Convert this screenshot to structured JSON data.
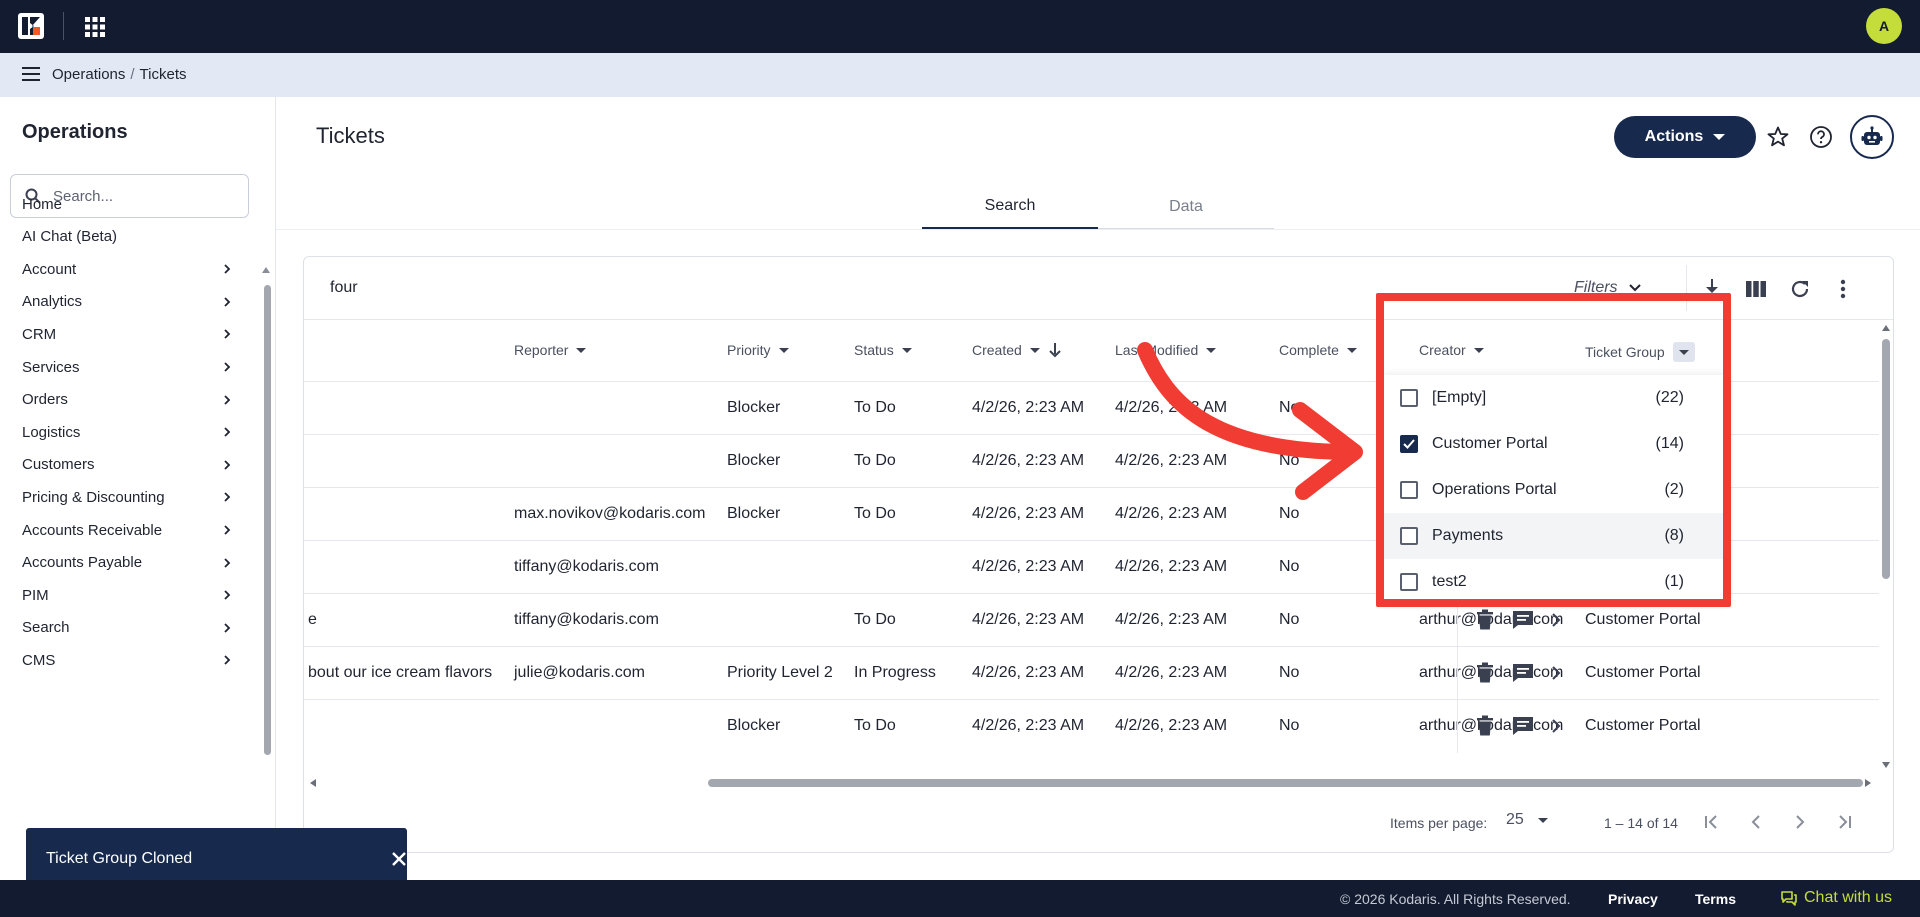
{
  "topbar": {
    "avatar_initial": "A"
  },
  "breadcrumb": {
    "items": [
      "Operations",
      "Tickets"
    ],
    "separator": "/"
  },
  "sidebar": {
    "title": "Operations",
    "search_placeholder": "Search...",
    "items": [
      {
        "label": "Home",
        "has_children": false
      },
      {
        "label": "AI Chat (Beta)",
        "has_children": false
      },
      {
        "label": "Account",
        "has_children": true
      },
      {
        "label": "Analytics",
        "has_children": true
      },
      {
        "label": "CRM",
        "has_children": true
      },
      {
        "label": "Services",
        "has_children": true
      },
      {
        "label": "Orders",
        "has_children": true
      },
      {
        "label": "Logistics",
        "has_children": true
      },
      {
        "label": "Customers",
        "has_children": true
      },
      {
        "label": "Pricing & Discounting",
        "has_children": true
      },
      {
        "label": "Accounts Receivable",
        "has_children": true
      },
      {
        "label": "Accounts Payable",
        "has_children": true
      },
      {
        "label": "PIM",
        "has_children": true
      },
      {
        "label": "Search",
        "has_children": true
      },
      {
        "label": "CMS",
        "has_children": true
      }
    ]
  },
  "page": {
    "title": "Tickets",
    "actions_label": "Actions",
    "tabs": [
      "Search",
      "Data"
    ],
    "active_tab": "Search"
  },
  "toolbar": {
    "search_value": "four",
    "filters_label": "Filters"
  },
  "table": {
    "columns": {
      "reporter": "Reporter",
      "priority": "Priority",
      "status": "Status",
      "created": "Created",
      "last_modified": "Last Modified",
      "complete": "Complete",
      "creator": "Creator",
      "ticket_group": "Ticket Group"
    },
    "rows": [
      {
        "title": "",
        "reporter": "",
        "priority": "Blocker",
        "status": "To Do",
        "created": "4/2/26, 2:23 AM",
        "last_modified": "4/2/26, 2:23 AM",
        "complete": "No",
        "creator": "",
        "ticket_group": ""
      },
      {
        "title": "",
        "reporter": "",
        "priority": "Blocker",
        "status": "To Do",
        "created": "4/2/26, 2:23 AM",
        "last_modified": "4/2/26, 2:23 AM",
        "complete": "No",
        "creator": "",
        "ticket_group": ""
      },
      {
        "title": "",
        "reporter": "max.novikov@kodaris.com",
        "priority": "Blocker",
        "status": "To Do",
        "created": "4/2/26, 2:23 AM",
        "last_modified": "4/2/26, 2:23 AM",
        "complete": "No",
        "creator": "",
        "ticket_group": ""
      },
      {
        "title": "",
        "reporter": "tiffany@kodaris.com",
        "priority": "",
        "status": "",
        "created": "4/2/26, 2:23 AM",
        "last_modified": "4/2/26, 2:23 AM",
        "complete": "No",
        "creator": "",
        "ticket_group": ""
      },
      {
        "title": "e",
        "reporter": "tiffany@kodaris.com",
        "priority": "",
        "status": "To Do",
        "created": "4/2/26, 2:23 AM",
        "last_modified": "4/2/26, 2:23 AM",
        "complete": "No",
        "creator": "arthur@kodaris.com",
        "ticket_group": "Customer Portal"
      },
      {
        "title": "bout our ice cream flavors",
        "reporter": "julie@kodaris.com",
        "priority": "Priority Level 2",
        "status": "In Progress",
        "created": "4/2/26, 2:23 AM",
        "last_modified": "4/2/26, 2:23 AM",
        "complete": "No",
        "creator": "arthur@kodaris.com",
        "ticket_group": "Customer Portal"
      },
      {
        "title": "",
        "reporter": "",
        "priority": "Blocker",
        "status": "To Do",
        "created": "4/2/26, 2:23 AM",
        "last_modified": "4/2/26, 2:23 AM",
        "complete": "No",
        "creator": "arthur@kodaris.com",
        "ticket_group": "Customer Portal"
      }
    ]
  },
  "ticket_group_filter": {
    "options": [
      {
        "label": "[Empty]",
        "count": "(22)",
        "checked": false
      },
      {
        "label": "Customer Portal",
        "count": "(14)",
        "checked": true
      },
      {
        "label": "Operations Portal",
        "count": "(2)",
        "checked": false
      },
      {
        "label": "Payments",
        "count": "(8)",
        "checked": false
      },
      {
        "label": "test2",
        "count": "(1)",
        "checked": false
      }
    ]
  },
  "pagination": {
    "items_per_page_label": "Items per page:",
    "items_per_page": "25",
    "range": "1 – 14 of 14"
  },
  "toast": {
    "message": "Ticket Group Cloned"
  },
  "footer": {
    "copyright": "© 2026 Kodaris. All Rights Reserved.",
    "privacy": "Privacy",
    "terms": "Terms",
    "chat": "Chat with us"
  },
  "colors": {
    "nav_dark": "#131b30",
    "primary": "#172a4e",
    "accent_lime": "#c5dd3a",
    "annotation_red": "#f03c32"
  },
  "icons": {
    "app": "kodaris-logo",
    "apps": "grid-icon",
    "menu": "hamburger-icon",
    "download": "download-icon",
    "columns": "columns-icon",
    "refresh": "refresh-icon",
    "more": "more-vert-icon",
    "delete": "trash-icon",
    "comment": "comment-icon",
    "open": "chevron-right-icon"
  }
}
